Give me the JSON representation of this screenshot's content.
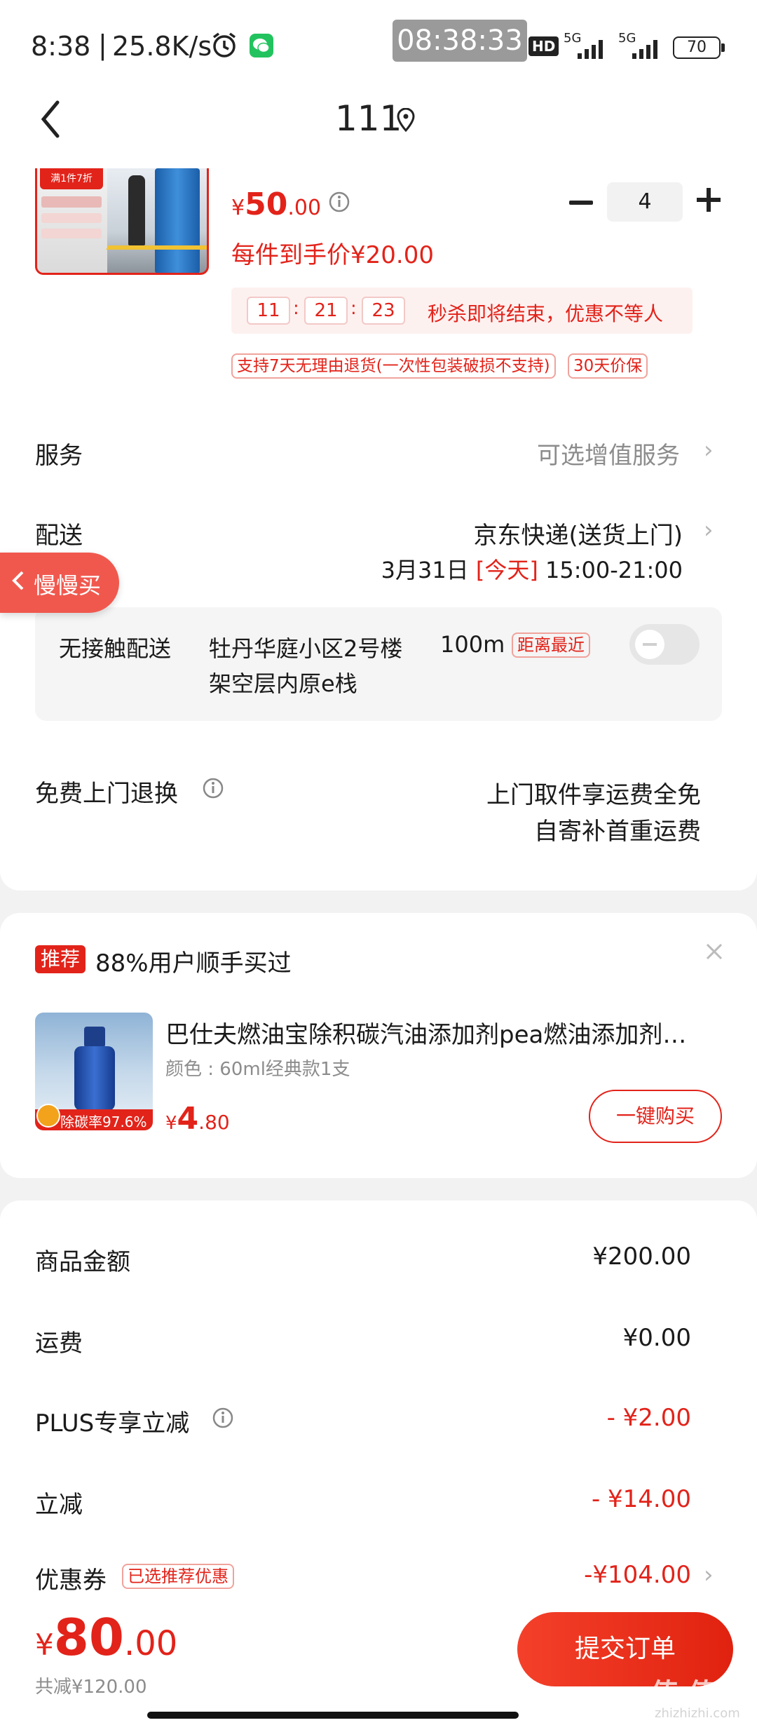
{
  "status_bar": {
    "time": "8:38",
    "speed": "25.8K/s",
    "clock_overlay": "08:38:33",
    "hd": "HD",
    "net1": "5G",
    "net2": "5G",
    "battery": "70"
  },
  "header": {
    "title": "111"
  },
  "product": {
    "price_symbol": "¥",
    "price_int": "50",
    "price_dec": ".00",
    "quantity": "4",
    "unit_price": "每件到手价¥20.00",
    "promo_badge": "满1件7折",
    "countdown": {
      "h": "11",
      "m": "21",
      "s": "23",
      "text": "秒杀即将结束，优惠不等人"
    },
    "tags": [
      "支持7天无理由退货(一次性包装破损不支持)",
      "30天价保"
    ]
  },
  "service": {
    "label": "服务",
    "value": "可选增值服务"
  },
  "delivery": {
    "label": "配送",
    "method": "京东快递(送货上门)",
    "date": "3月31日",
    "today": "[今天]",
    "slot": "15:00-21:00"
  },
  "float_button": {
    "label": "慢慢买"
  },
  "contactless": {
    "label": "无接触配送",
    "address_line1": "牡丹华庭小区2号楼",
    "distance": "100m",
    "badge": "距离最近",
    "address_line2": "架空层内原e栈"
  },
  "free_return": {
    "label": "免费上门退换",
    "line1": "上门取件享运费全免",
    "line2": "自寄补首重运费"
  },
  "recommend": {
    "tag": "推荐",
    "title": "88%用户顺手买过",
    "product_name": "巴仕夫燃油宝除积碳汽油添加剂pea燃油添加剂…",
    "spec": "颜色 : 60ml经典款1支",
    "thumb_badge": "除碳率97.6%",
    "price_symbol": "¥",
    "price_int": "4",
    "price_dec": ".80",
    "buy_button": "一键购买"
  },
  "summary": {
    "rows": [
      {
        "label": "商品金额",
        "value": "¥200.00"
      },
      {
        "label": "运费",
        "value": "¥0.00"
      },
      {
        "label": "PLUS专享立减",
        "value": "- ¥2.00"
      },
      {
        "label": "立减",
        "value": "- ¥14.00"
      },
      {
        "label": "优惠券",
        "value": "-¥104.00",
        "tag": "已选推荐优惠"
      }
    ]
  },
  "bottom": {
    "price_symbol": "¥",
    "price_int": "80",
    "price_dec": ".00",
    "saved": "共减¥120.00",
    "submit": "提交订单",
    "watermark": "值 值 值",
    "watermark_sub": "zhizhizhi.com"
  },
  "colors": {
    "accent": "#e2231a",
    "submit_gradient": [
      "#f4402a",
      "#e0220f"
    ]
  }
}
